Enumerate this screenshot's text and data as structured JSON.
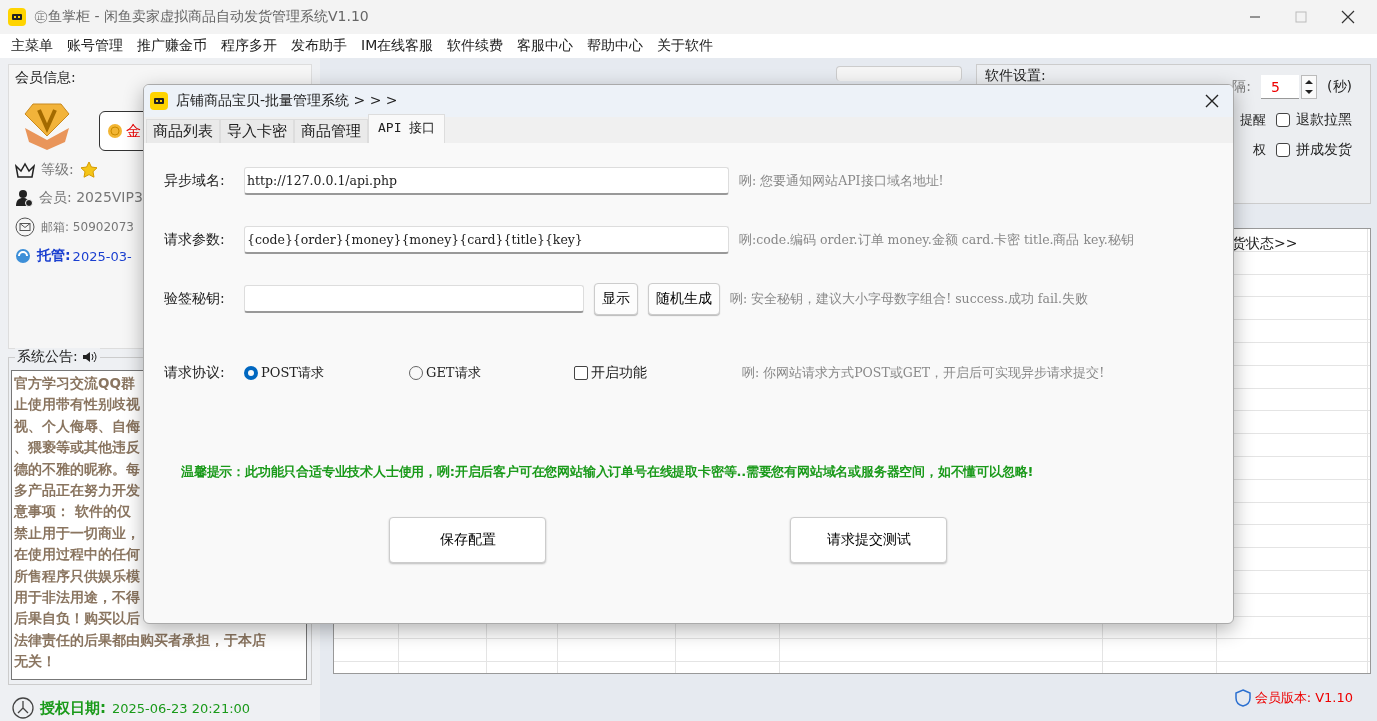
{
  "window": {
    "title": "㊣鱼掌柜 - 闲鱼卖家虚拟商品自动发货管理系统V1.10"
  },
  "menu": [
    "主菜单",
    "账号管理",
    "推广赚金币",
    "程序多开",
    "发布助手",
    "IM在线客服",
    "软件续费",
    "客服中心",
    "帮助中心",
    "关于软件"
  ],
  "member": {
    "title": "会员信息:",
    "coin": "金",
    "level": "等级:",
    "member": "会员: 2025VIP3",
    "email": "邮箱: 50902073",
    "hosting_label": "托管:",
    "hosting_value": "2025-03-"
  },
  "notice": {
    "title": "系统公告:",
    "lines": [
      "官方学习交流QQ群",
      "止使用带有性别歧视",
      "视、个人侮辱、自侮",
      "、猥亵等或其他违反",
      "德的不雅的昵称。每",
      "多产品正在努力开发",
      "意事项： 软件的仅",
      "禁止用于一切商业，",
      "在使用过程中的任何",
      "所售程序只供娱乐模",
      "用于非法用途，不得",
      "后果自负！购买以后",
      "法律责任的后果都由购买者承担，于本店",
      "无关！"
    ]
  },
  "auth": {
    "label": "授权日期:",
    "value": "2025-06-23 20:21:00"
  },
  "settings": {
    "title": "软件设置:",
    "interval_label": "隔:",
    "interval_value": "5",
    "unit": "(秒)",
    "cut_labels": [
      "提醒",
      "权"
    ],
    "checkboxes": [
      {
        "label": "退款拉黑",
        "checked": false
      },
      {
        "label": "拼成发货",
        "checked": false
      }
    ]
  },
  "table": {
    "header": "货状态>>"
  },
  "version": "会员版本: V1.10",
  "dialog": {
    "title": "店铺商品宝贝-批量管理系统 > > >",
    "tabs": [
      {
        "label": "商品列表",
        "selected": false
      },
      {
        "label": "导入卡密",
        "selected": false
      },
      {
        "label": "商品管理",
        "selected": false
      },
      {
        "label": "API 接口",
        "selected": true
      }
    ],
    "fields": [
      {
        "label": "异步域名:",
        "value": "http://127.0.0.1/api.php",
        "hint": "咧: 您要通知网站API接口域名地址!"
      },
      {
        "label": "请求参数:",
        "value": "{code}{order}{money}{money}{card}{title}{key}",
        "hint": "咧:code.编码 order.订单 money.金额 card.卡密 title.商品 key.秘钥"
      }
    ],
    "secret": {
      "label": "验签秘钥:",
      "buttons": [
        "显示",
        "随机生成"
      ],
      "hint": "咧: 安全秘钥，建议大小字母数字组合! success.成功 fail.失败"
    },
    "protocol": {
      "label": "请求协议:",
      "options": [
        {
          "label": "POST请求",
          "selected": true
        },
        {
          "label": "GET请求",
          "selected": false
        }
      ],
      "enable": {
        "label": "开启功能",
        "checked": false
      },
      "hint": "咧: 你网站请求方式POST或GET，开启后可实现异步请求提交!"
    },
    "tip": "温馨提示：此功能只合适专业技术人士使用，咧:开启后客户可在您网站输入订单号在线提取卡密等..需要您有网站域名或服务器空间，如不懂可以忽略!",
    "buttons": [
      "保存配置",
      "请求提交测试"
    ]
  }
}
